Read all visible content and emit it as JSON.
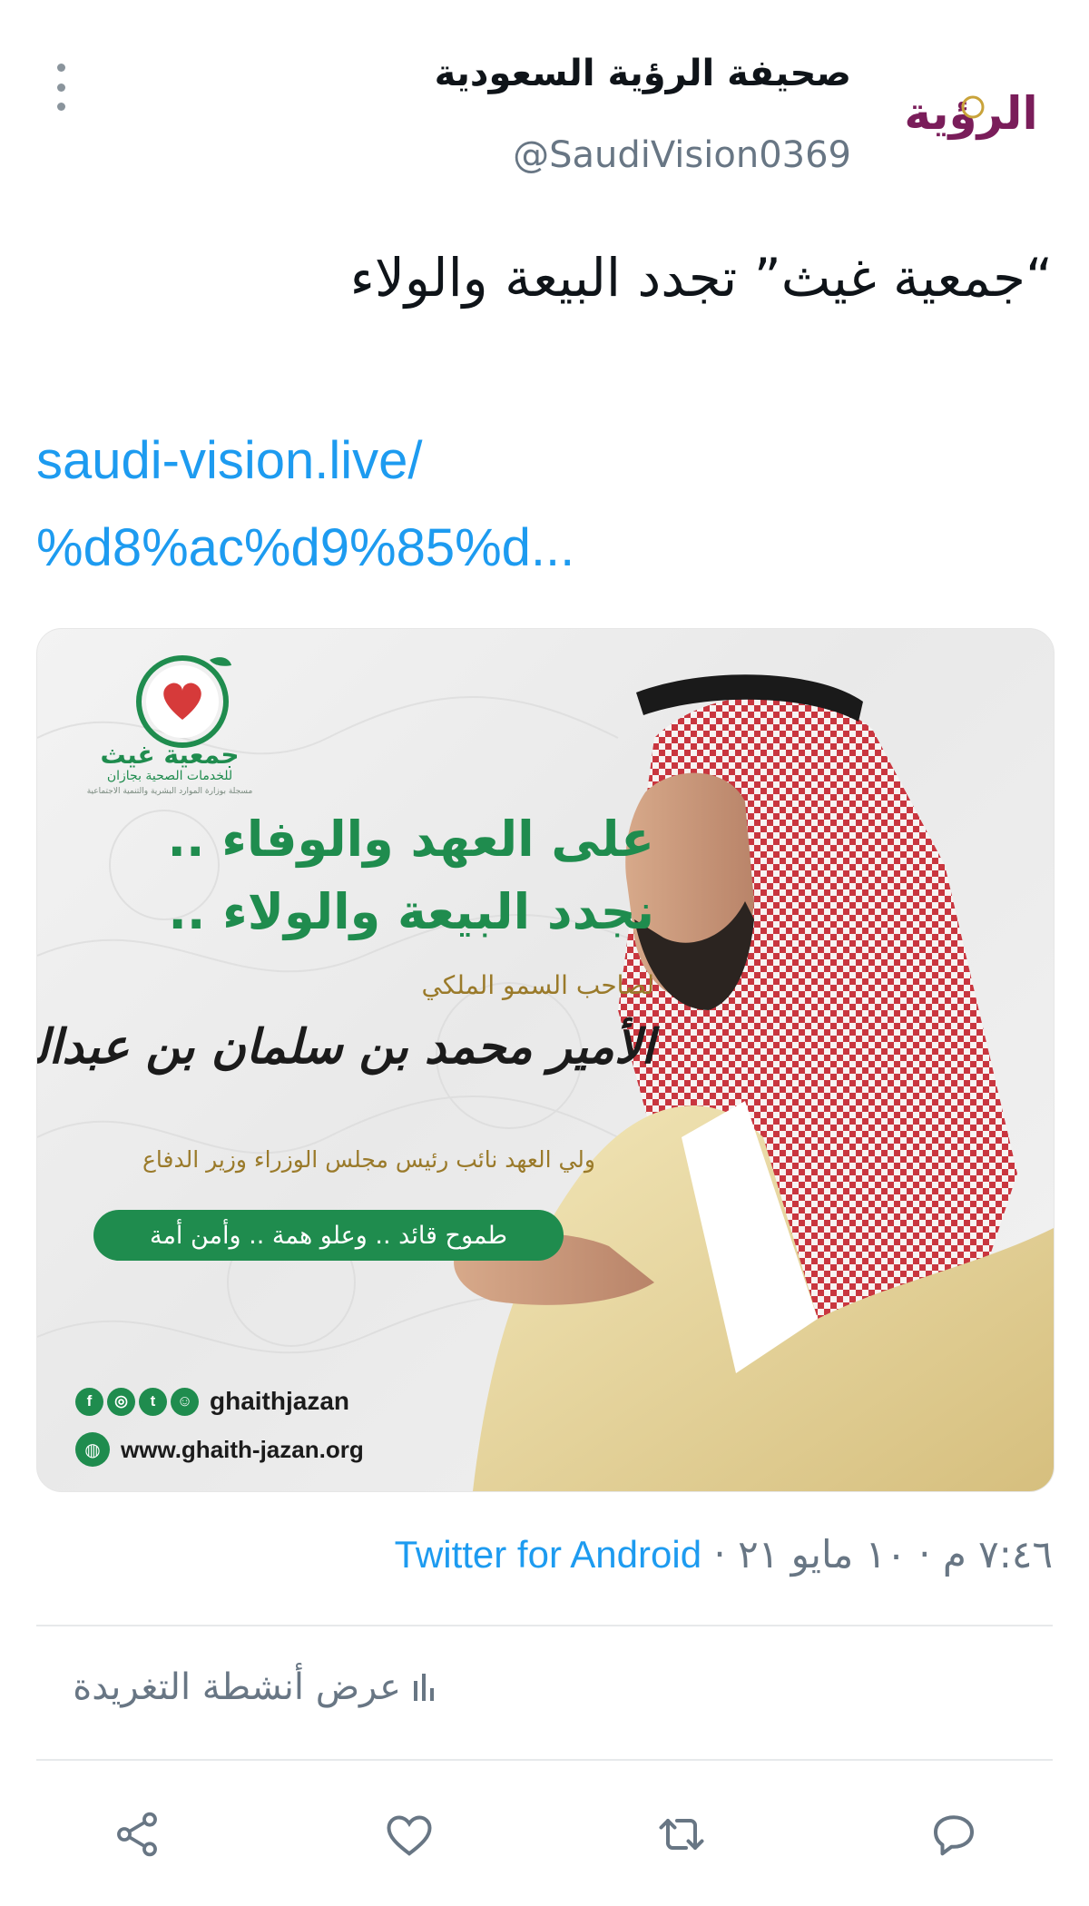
{
  "tweet": {
    "display_name": "صحيفة الرؤية السعودية",
    "handle": "@SaudiVision0369",
    "avatar_text": "الرؤية",
    "text": "“جمعية غيث” تجدد البيعة والولاء",
    "link_line1": "saudi-vision.live/",
    "link_line2": "%d8%ac%d9%85%d...",
    "timestamp": "٧:٤٦ م · ١٠ مايو ٢١",
    "separator": " · ",
    "source": "Twitter for Android",
    "activity_label": "عرض أنشطة التغريدة"
  },
  "media": {
    "org_name": "جمعية غيث",
    "org_subtitle": "للخدمات الصحية بجازان",
    "org_license": "مسجلة بوزارة الموارد البشرية والتنمية الاجتماعية",
    "headline_line1": "على العهد والوفاء ..",
    "headline_line2": "نجدد البيعة والولاء ..",
    "highness": "لصاحب السمو الملكي",
    "prince_name": "الأمير محمد بن سلمان بن عبدالعزيز آل سعود",
    "prince_title": "ولي العهد نائب رئيس مجلس الوزراء وزير الدفاع",
    "slogan": "طموح قائد .. وعلو همة .. وأمن أمة",
    "social_handle": "ghaithjazan",
    "website": "www.ghaith-jazan.org",
    "social_icons": [
      "facebook-icon",
      "instagram-icon",
      "twitter-icon",
      "snapchat-icon"
    ]
  },
  "colors": {
    "link_blue": "#1d9bf0",
    "secondary_gray": "#687684",
    "brand_green": "#1f8c4e",
    "gold": "#9a7a2a",
    "avatar_purple": "#7a1d5a"
  },
  "actions": [
    "share-icon",
    "like-icon",
    "retweet-icon",
    "reply-icon"
  ]
}
